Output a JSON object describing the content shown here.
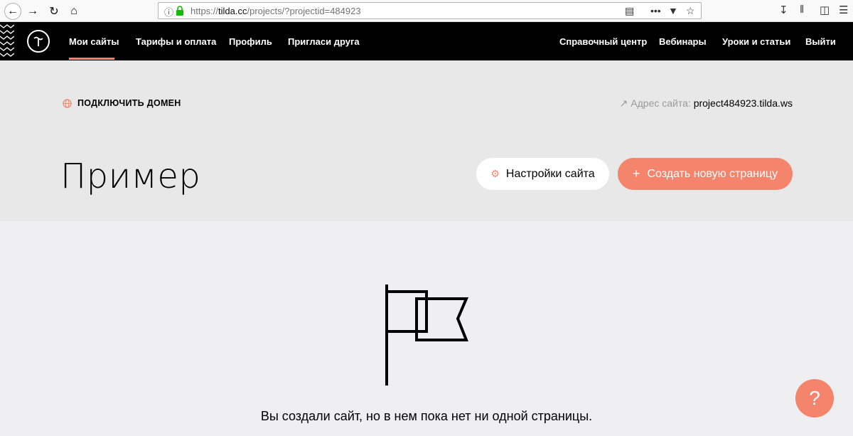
{
  "browser": {
    "url_domain": "tilda.cc",
    "url_prefix": "https://",
    "url_path": "/projects/?projectid=484923"
  },
  "nav": {
    "left_items": [
      "Мои сайты",
      "Тарифы и оплата",
      "Профиль",
      "Пригласи друга"
    ],
    "right_items": [
      "Справочный центр",
      "Вебинары",
      "Уроки и статьи",
      "Выйти"
    ],
    "active_item": "Мои сайты",
    "accent_color": "#f4846b"
  },
  "header": {
    "connect_domain_label": "ПОДКЛЮЧИТЬ ДОМЕН",
    "site_address_label": "Адрес сайта:",
    "site_address_value": "project484923.tilda.ws",
    "project_title": "Пример",
    "settings_button_label": "Настройки сайта",
    "create_page_button_label": "Создать новую страницу"
  },
  "empty_state": {
    "icon": "flag-icon",
    "message": "Вы создали сайт, но в нем пока нет ни одной страницы."
  },
  "help": {
    "label": "?"
  }
}
